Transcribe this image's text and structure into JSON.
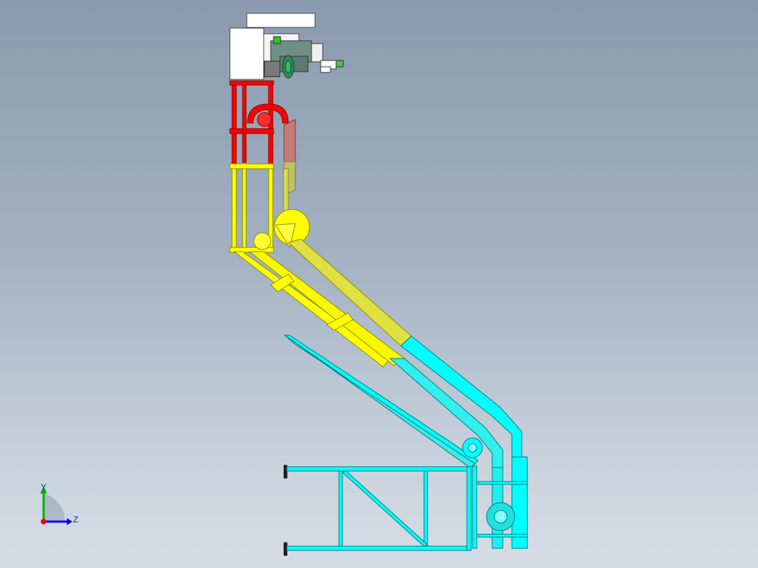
{
  "viewport": {
    "background_top": "#8a9aae",
    "background_bottom": "#d6dde6"
  },
  "model": {
    "parts": [
      {
        "name": "drive-unit",
        "color": "#ffffff"
      },
      {
        "name": "motor-flange",
        "color": "#2e8b57"
      },
      {
        "name": "head-section",
        "color": "#ff0000"
      },
      {
        "name": "upper-inclined-section",
        "color": "#ffff00"
      },
      {
        "name": "lower-inclined-section",
        "color": "#00ffff"
      },
      {
        "name": "base-frame",
        "color": "#00ffff"
      },
      {
        "name": "guard-panel",
        "color": "#c87a7a"
      }
    ]
  },
  "triad": {
    "y_label": "Y",
    "z_label": "Z",
    "y_color": "#00b000",
    "z_color": "#0000ff",
    "origin_color": "#ff0000"
  }
}
